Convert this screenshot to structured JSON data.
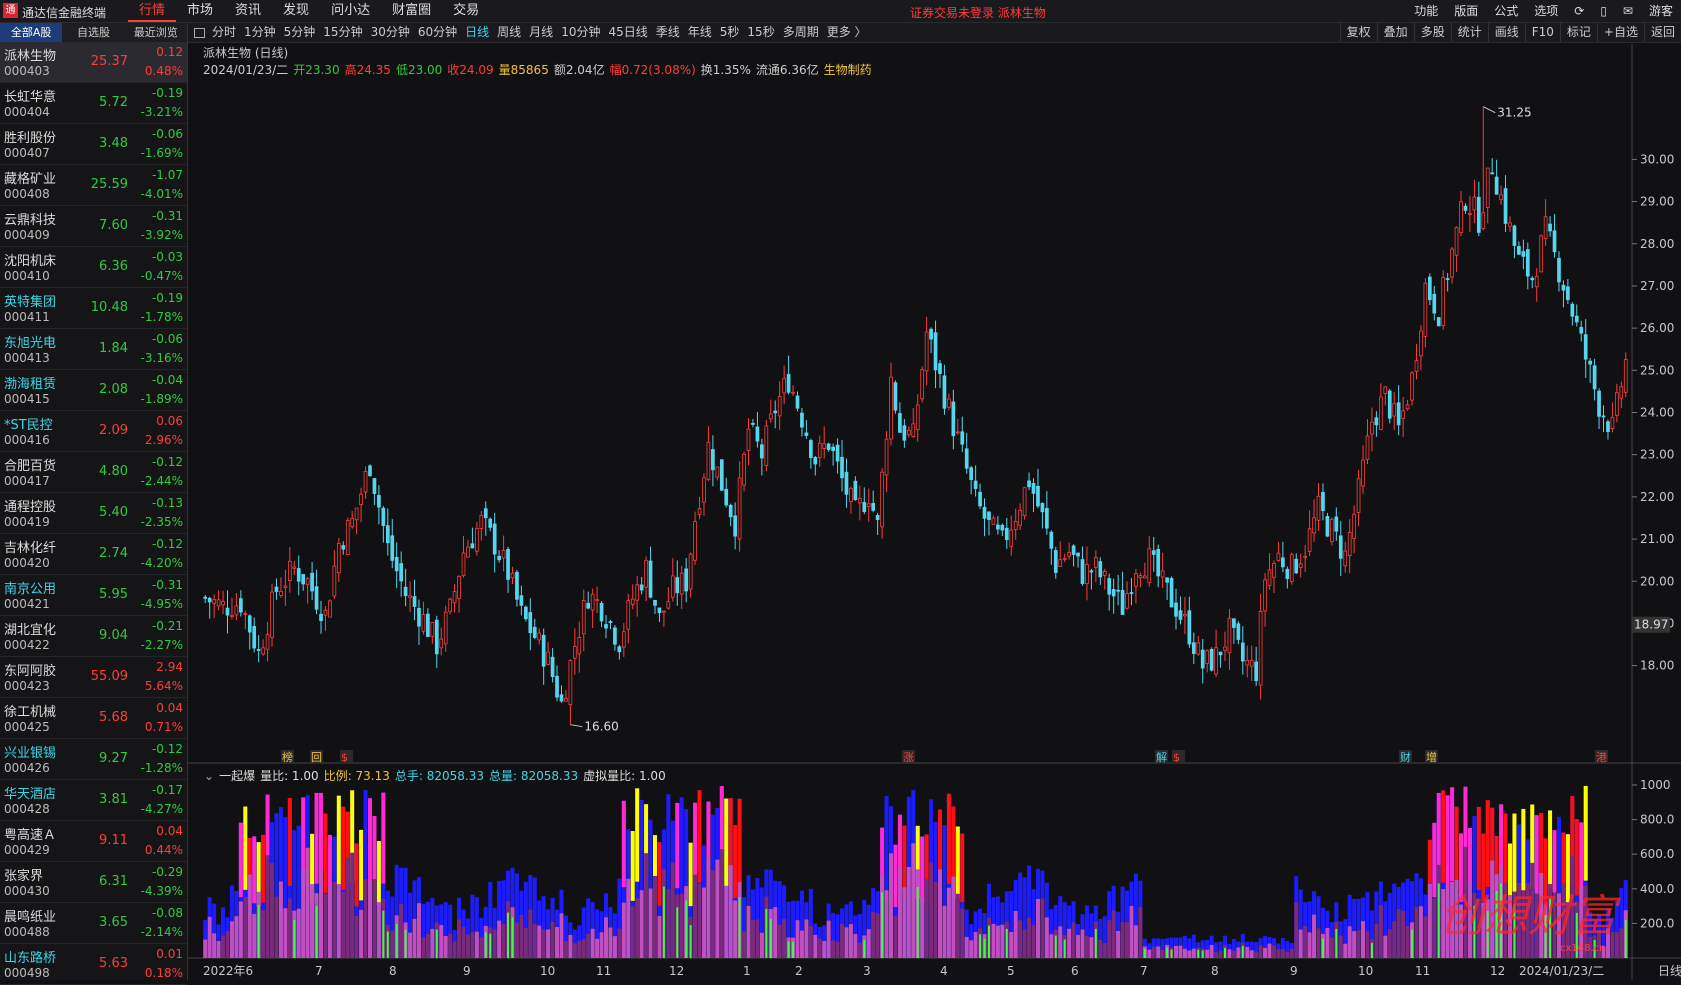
{
  "app": {
    "title": "通达信金融终端",
    "logo_text": "通"
  },
  "main_nav": [
    "行情",
    "市场",
    "资讯",
    "发现",
    "问小达",
    "财富圈",
    "交易"
  ],
  "notice": "证券交易未登录  派林生物",
  "right_nav": [
    "功能",
    "版面",
    "公式",
    "选项",
    "游客"
  ],
  "sidebar": {
    "tabs": [
      "全部A股",
      "自选股",
      "最近浏览"
    ],
    "stocks": [
      {
        "name": "派林生物",
        "code": "000403",
        "price": "25.37",
        "change": "0.12",
        "pct": "0.48%",
        "dir": "up",
        "cyan": false
      },
      {
        "name": "长虹华意",
        "code": "000404",
        "price": "5.72",
        "change": "-0.19",
        "pct": "-3.21%",
        "dir": "dn",
        "cyan": false
      },
      {
        "name": "胜利股份",
        "code": "000407",
        "price": "3.48",
        "change": "-0.06",
        "pct": "-1.69%",
        "dir": "dn",
        "cyan": false
      },
      {
        "name": "藏格矿业",
        "code": "000408",
        "price": "25.59",
        "change": "-1.07",
        "pct": "-4.01%",
        "dir": "dn",
        "cyan": false
      },
      {
        "name": "云鼎科技",
        "code": "000409",
        "price": "7.60",
        "change": "-0.31",
        "pct": "-3.92%",
        "dir": "dn",
        "cyan": false
      },
      {
        "name": "沈阳机床",
        "code": "000410",
        "price": "6.36",
        "change": "-0.03",
        "pct": "-0.47%",
        "dir": "dn",
        "cyan": false
      },
      {
        "name": "英特集团",
        "code": "000411",
        "price": "10.48",
        "change": "-0.19",
        "pct": "-1.78%",
        "dir": "dn",
        "cyan": true
      },
      {
        "name": "东旭光电",
        "code": "000413",
        "price": "1.84",
        "change": "-0.06",
        "pct": "-3.16%",
        "dir": "dn",
        "cyan": true
      },
      {
        "name": "渤海租赁",
        "code": "000415",
        "price": "2.08",
        "change": "-0.04",
        "pct": "-1.89%",
        "dir": "dn",
        "cyan": true
      },
      {
        "name": "*ST民控",
        "code": "000416",
        "price": "2.09",
        "change": "0.06",
        "pct": "2.96%",
        "dir": "up",
        "cyan": true
      },
      {
        "name": "合肥百货",
        "code": "000417",
        "price": "4.80",
        "change": "-0.12",
        "pct": "-2.44%",
        "dir": "dn",
        "cyan": false
      },
      {
        "name": "通程控股",
        "code": "000419",
        "price": "5.40",
        "change": "-0.13",
        "pct": "-2.35%",
        "dir": "dn",
        "cyan": false
      },
      {
        "name": "吉林化纤",
        "code": "000420",
        "price": "2.74",
        "change": "-0.12",
        "pct": "-4.20%",
        "dir": "dn",
        "cyan": false
      },
      {
        "name": "南京公用",
        "code": "000421",
        "price": "5.95",
        "change": "-0.31",
        "pct": "-4.95%",
        "dir": "dn",
        "cyan": true
      },
      {
        "name": "湖北宜化",
        "code": "000422",
        "price": "9.04",
        "change": "-0.21",
        "pct": "-2.27%",
        "dir": "dn",
        "cyan": false
      },
      {
        "name": "东阿阿胶",
        "code": "000423",
        "price": "55.09",
        "change": "2.94",
        "pct": "5.64%",
        "dir": "up",
        "cyan": false
      },
      {
        "name": "徐工机械",
        "code": "000425",
        "price": "5.68",
        "change": "0.04",
        "pct": "0.71%",
        "dir": "up",
        "cyan": false
      },
      {
        "name": "兴业银锡",
        "code": "000426",
        "price": "9.27",
        "change": "-0.12",
        "pct": "-1.28%",
        "dir": "dn",
        "cyan": true
      },
      {
        "name": "华天酒店",
        "code": "000428",
        "price": "3.81",
        "change": "-0.17",
        "pct": "-4.27%",
        "dir": "dn",
        "cyan": true
      },
      {
        "name": "粤高速Ａ",
        "code": "000429",
        "price": "9.11",
        "change": "0.04",
        "pct": "0.44%",
        "dir": "up",
        "cyan": false
      },
      {
        "name": "张家界",
        "code": "000430",
        "price": "6.31",
        "change": "-0.29",
        "pct": "-4.39%",
        "dir": "dn",
        "cyan": false
      },
      {
        "name": "晨鸣纸业",
        "code": "000488",
        "price": "3.65",
        "change": "-0.08",
        "pct": "-2.14%",
        "dir": "dn",
        "cyan": false
      },
      {
        "name": "山东路桥",
        "code": "000498",
        "price": "5.63",
        "change": "0.01",
        "pct": "0.18%",
        "dir": "up",
        "cyan": true
      }
    ]
  },
  "periods": [
    "分时",
    "1分钟",
    "5分钟",
    "15分钟",
    "30分钟",
    "60分钟",
    "日线",
    "周线",
    "月线",
    "10分钟",
    "45日线",
    "季线",
    "年线",
    "5秒",
    "15秒",
    "多周期",
    "更多 〉"
  ],
  "active_period": "日线",
  "tools": [
    "复权",
    "叠加",
    "多股",
    "统计",
    "画线",
    "F10",
    "标记",
    "+自选",
    "返回"
  ],
  "chart_title": "派林生物 (日线)",
  "info": {
    "date": "2024/01/23/二",
    "open": "开23.30",
    "high": "高24.35",
    "low": "低23.00",
    "close": "收24.09",
    "vol": "量85865",
    "amt": "额2.04亿",
    "amp": "幅0.72(3.08%)",
    "turn": "换1.35%",
    "float": "流通6.36亿",
    "industry": "生物制药"
  },
  "price_axis": {
    "ticks": [
      "30.00",
      "29.00",
      "28.00",
      "27.00",
      "26.00",
      "25.00",
      "24.00",
      "23.00",
      "22.00",
      "21.00",
      "20.00",
      "19.00",
      "18.00"
    ],
    "current": "18.97",
    "max_label": "31.25",
    "min_label": "16.60"
  },
  "event_markers": [
    "榜",
    "回",
    "$",
    "涨",
    "解",
    "$",
    "财",
    "增",
    "港"
  ],
  "sub": {
    "name": "一起爆",
    "ratio": "量比: 1.00",
    "bili": "比例: 73.13",
    "zongshou": "总手: 82058.33",
    "zongliang": "总量: 82058.33",
    "xuni": "虚拟量比: 1.00",
    "axis": [
      "1000",
      "800.0",
      "600.0",
      "400.0",
      "200.0"
    ]
  },
  "time_axis": [
    "2022年6",
    "7",
    "8",
    "9",
    "10",
    "11",
    "12",
    "1",
    "2",
    "3",
    "4",
    "5",
    "6",
    "7",
    "8",
    "9",
    "10",
    "11",
    "12",
    "2024/01/23/二",
    "日线"
  ],
  "watermark": "创想财富",
  "watermark_url": "cx168.cn",
  "chart_data": {
    "type": "candlestick",
    "title": "派林生物 (日线)",
    "ylim": [
      16.0,
      32.0
    ],
    "x": [
      "2022-06",
      "2022-07",
      "2022-08",
      "2022-09",
      "2022-10",
      "2022-11",
      "2022-12",
      "2023-01",
      "2023-02",
      "2023-03",
      "2023-04",
      "2023-05",
      "2023-06",
      "2023-07",
      "2023-08",
      "2023-09",
      "2023-10",
      "2023-11",
      "2023-12",
      "2024-01"
    ],
    "close_path": [
      [
        0,
        19.6
      ],
      [
        4,
        19.4
      ],
      [
        8,
        19.5
      ],
      [
        12,
        18.3
      ],
      [
        16,
        19.8
      ],
      [
        20,
        20.3
      ],
      [
        23,
        20.0
      ],
      [
        27,
        19.2
      ],
      [
        30,
        20.9
      ],
      [
        33,
        21.4
      ],
      [
        37,
        22.8
      ],
      [
        41,
        20.8
      ],
      [
        45,
        19.7
      ],
      [
        49,
        19.1
      ],
      [
        52,
        18.5
      ],
      [
        55,
        19.3
      ],
      [
        58,
        20.7
      ],
      [
        62,
        21.4
      ],
      [
        65,
        20.9
      ],
      [
        68,
        20.2
      ],
      [
        71,
        19.2
      ],
      [
        74,
        18.7
      ],
      [
        77,
        18.1
      ],
      [
        80,
        17.1
      ],
      [
        83,
        18.5
      ],
      [
        86,
        19.7
      ],
      [
        89,
        19.4
      ],
      [
        93,
        18.6
      ],
      [
        96,
        19.6
      ],
      [
        99,
        20.3
      ],
      [
        102,
        19.1
      ],
      [
        105,
        19.8
      ],
      [
        108,
        20.0
      ],
      [
        110,
        21.5
      ],
      [
        113,
        23.2
      ],
      [
        116,
        22.3
      ],
      [
        119,
        21.4
      ],
      [
        122,
        23.6
      ],
      [
        125,
        23.0
      ],
      [
        128,
        24.1
      ],
      [
        131,
        24.8
      ],
      [
        134,
        23.9
      ],
      [
        137,
        22.9
      ],
      [
        140,
        23.3
      ],
      [
        143,
        22.4
      ],
      [
        146,
        21.6
      ],
      [
        149,
        22.1
      ],
      [
        151,
        21.3
      ],
      [
        154,
        24.8
      ],
      [
        156,
        23.6
      ],
      [
        159,
        23.4
      ],
      [
        162,
        25.9
      ],
      [
        165,
        24.8
      ],
      [
        168,
        23.7
      ],
      [
        170,
        23.0
      ],
      [
        173,
        21.9
      ],
      [
        176,
        21.3
      ],
      [
        179,
        20.9
      ],
      [
        182,
        21.6
      ],
      [
        185,
        22.4
      ],
      [
        188,
        21.5
      ],
      [
        191,
        20.4
      ],
      [
        194,
        20.7
      ],
      [
        197,
        20.2
      ],
      [
        200,
        20.3
      ],
      [
        203,
        19.8
      ],
      [
        206,
        19.4
      ],
      [
        209,
        20.4
      ],
      [
        212,
        20.5
      ],
      [
        215,
        19.9
      ],
      [
        218,
        19.4
      ],
      [
        221,
        18.8
      ],
      [
        224,
        18.0
      ],
      [
        227,
        18.2
      ],
      [
        230,
        18.8
      ],
      [
        233,
        18.1
      ],
      [
        236,
        17.9
      ],
      [
        238,
        20.1
      ],
      [
        241,
        20.6
      ],
      [
        244,
        20.3
      ],
      [
        247,
        20.8
      ],
      [
        250,
        21.7
      ],
      [
        253,
        21.2
      ],
      [
        256,
        20.6
      ],
      [
        259,
        22.1
      ],
      [
        262,
        23.8
      ],
      [
        265,
        24.4
      ],
      [
        268,
        23.6
      ],
      [
        271,
        24.8
      ],
      [
        274,
        27.0
      ],
      [
        277,
        26.4
      ],
      [
        280,
        27.8
      ],
      [
        283,
        29.1
      ],
      [
        286,
        28.6
      ],
      [
        289,
        29.9
      ],
      [
        292,
        28.7
      ],
      [
        295,
        27.6
      ],
      [
        298,
        27.2
      ],
      [
        301,
        28.3
      ],
      [
        304,
        27.4
      ],
      [
        307,
        26.4
      ],
      [
        310,
        25.3
      ],
      [
        313,
        24.2
      ],
      [
        316,
        23.6
      ],
      [
        319,
        25.2
      ]
    ],
    "max_point": {
      "bar": 287,
      "value": 31.25
    },
    "min_point": {
      "bar": 82,
      "value": 16.6
    },
    "volume_indicator": {
      "name": "一起爆",
      "axis_max": 1000
    }
  }
}
